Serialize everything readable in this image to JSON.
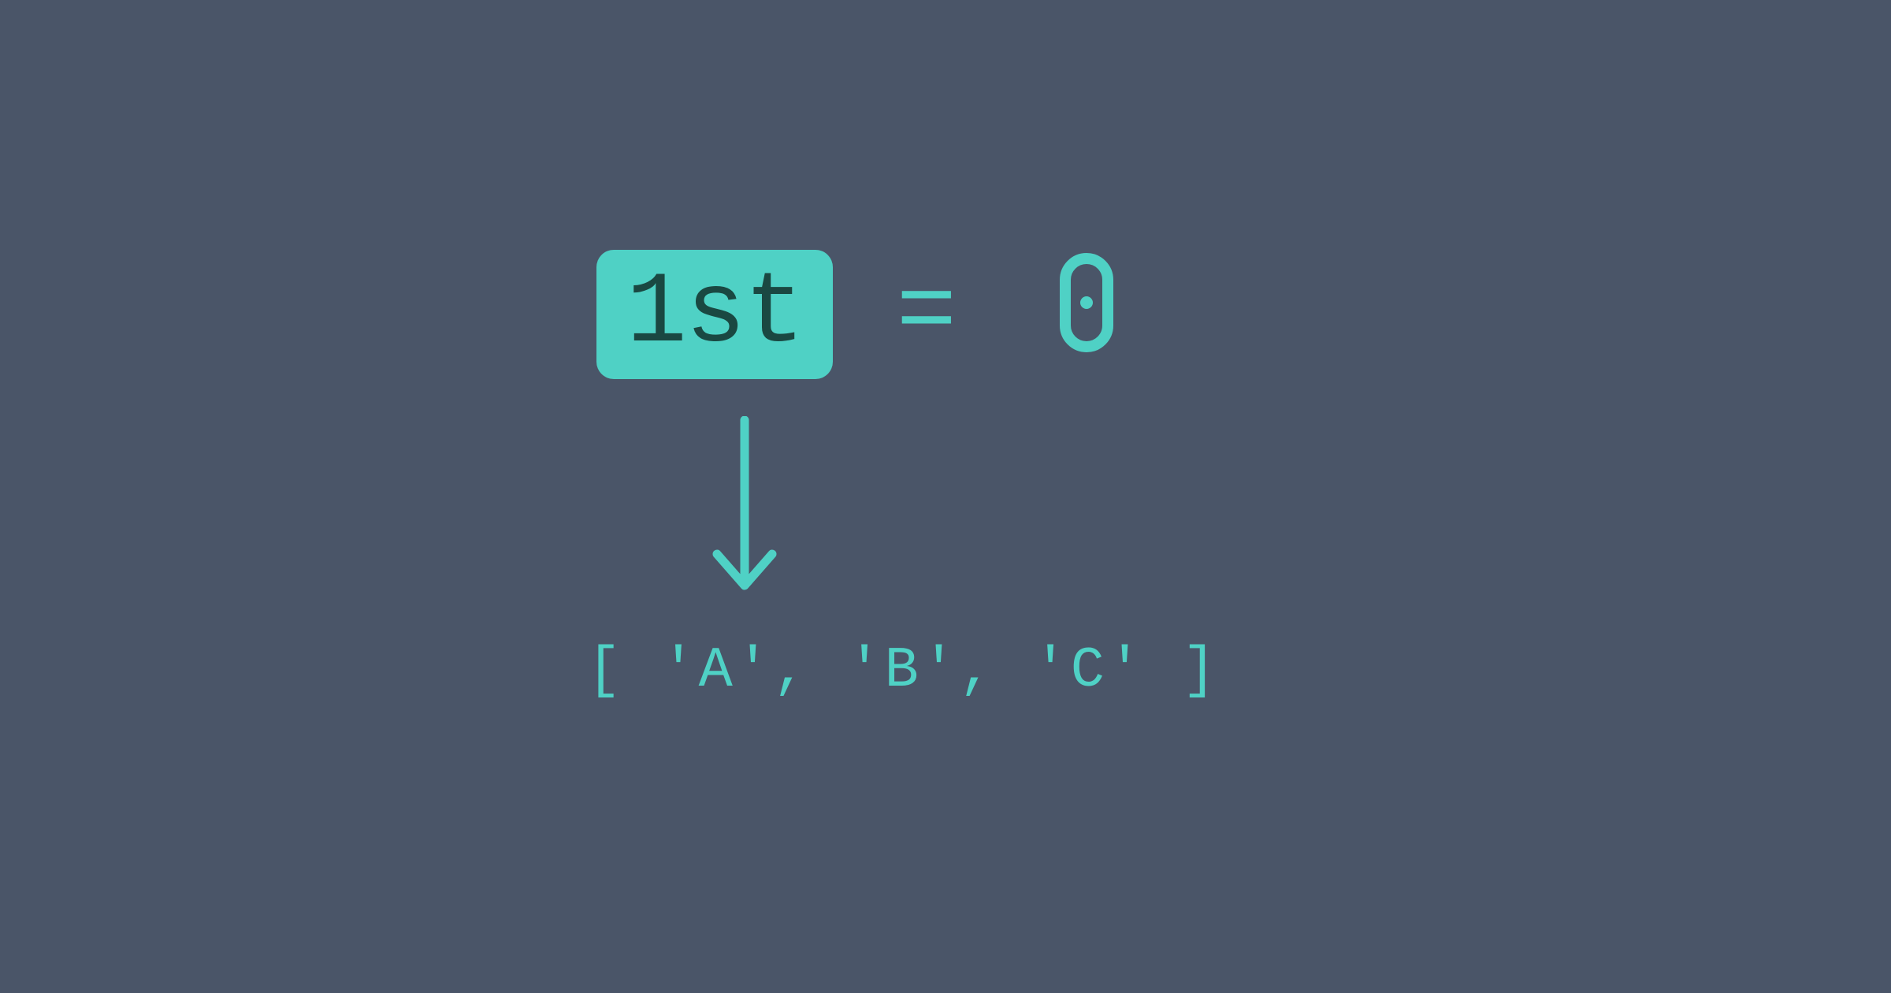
{
  "colors": {
    "background": "#4a5568",
    "accent": "#4fd1c5",
    "badge_text": "#1a4842"
  },
  "badge": {
    "label": "1st"
  },
  "equation": {
    "operator": "=",
    "result": "0"
  },
  "array": {
    "literal": "[ 'A', 'B', 'C' ]"
  },
  "icons": {
    "arrow": "down-arrow-icon"
  }
}
